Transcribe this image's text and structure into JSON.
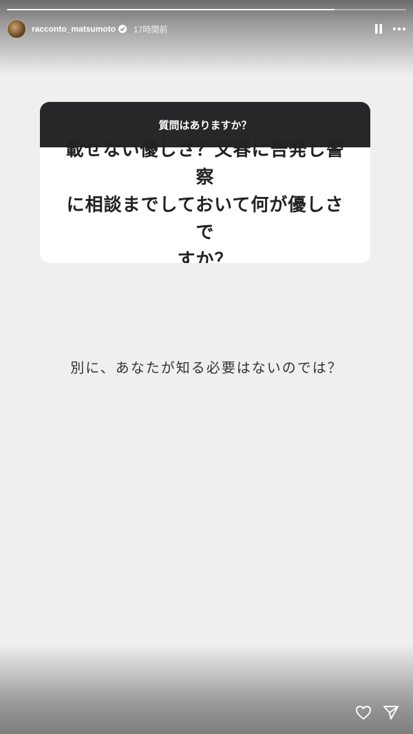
{
  "story": {
    "progress_fraction": 0.82
  },
  "header": {
    "username": "racconto_matsumoto",
    "time_ago": "17時間前",
    "verified": true,
    "icons": [
      "pause-icon",
      "more-icon"
    ]
  },
  "question_card": {
    "prompt": "質問はありますか？",
    "question_lines": [
      "載せない優しさ？文春に告発し警察",
      "に相談までしておいて何が優しさで",
      "すか？"
    ]
  },
  "answer_text": "別に、あなたが知る必要はないのでは？",
  "footer": {
    "icons": [
      "heart-icon",
      "send-icon"
    ]
  },
  "colors": {
    "background": "#efefef",
    "card_header": "#272729",
    "card_body": "#ffffff"
  }
}
